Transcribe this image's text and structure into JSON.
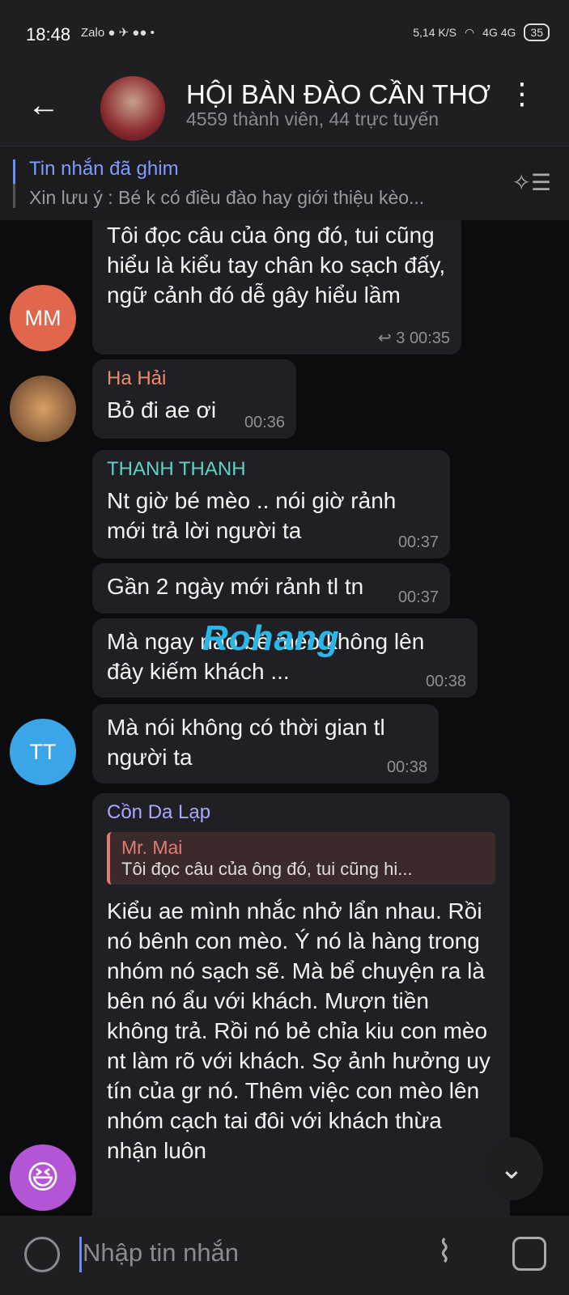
{
  "status_bar": {
    "time": "18:48",
    "app_icons": "Zalo ● ✈ ●● •",
    "net_speed": "5,14 K/S",
    "signal": "4G 4G",
    "battery": "35"
  },
  "header": {
    "title": "HỘI BÀN ĐÀO CẦN THƠ",
    "subtitle": "4559 thành viên, 44 trực tuyến"
  },
  "pinned": {
    "label": "Tin nhắn đã ghim",
    "preview": "Xin lưu ý : Bé k có điều đào hay giới thiệu kèo..."
  },
  "messages": [
    {
      "text": "Tôi đọc câu của ông đó, tui cũng hiểu là kiểu tay chân ko sạch đấy, ngữ cảnh đó dễ gây hiểu lầm",
      "replies": "3",
      "time": "00:35",
      "avatar_initials": "MM"
    },
    {
      "sender": "Ha Hải",
      "text": "Bỏ đi ae ơi",
      "time": "00:36"
    },
    {
      "sender": "THANH THANH",
      "text": "Nt giờ bé mèo  .. nói giờ rảnh mới trả lời người ta",
      "time": "00:37"
    },
    {
      "text": "Gần 2 ngày mới rảnh tl tn",
      "time": "00:37"
    },
    {
      "text": "Mà ngay nào bé mèo không lên đây kiếm khách ...",
      "time": "00:38"
    },
    {
      "text": "Mà nói không có thời gian tl người ta",
      "time": "00:38",
      "avatar_initials": "TT"
    },
    {
      "sender": "Cồn Da Lạp",
      "reply_name": "Mr. Mai",
      "reply_text": "Tôi đọc câu của ông đó, tui cũng hi...",
      "text": "Kiểu ae mình nhắc nhở lẩn nhau. Rồi nó bênh con mèo. Ý nó là hàng trong nhóm nó sạch sẽ. Mà bể chuyện ra là bên nó ẩu với khách. Mượn tiền không trả. Rồi nó bẻ chỉa kiu con mèo nt làm rõ với khách. Sợ ảnh hưởng uy tín của gr nó. Thêm việc con mèo lên nhóm cạch tai đôi với khách thừa nhận luôn"
    }
  ],
  "watermark": {
    "a": "Rohang",
    "b": ""
  },
  "composer": {
    "placeholder": "Nhập tin nhắn"
  },
  "colors": {
    "accent": "#7e9cff",
    "name_ha_hai": "#f08a6e",
    "name_thanh": "#5fd1c4",
    "name_con": "#a9a7ff"
  }
}
